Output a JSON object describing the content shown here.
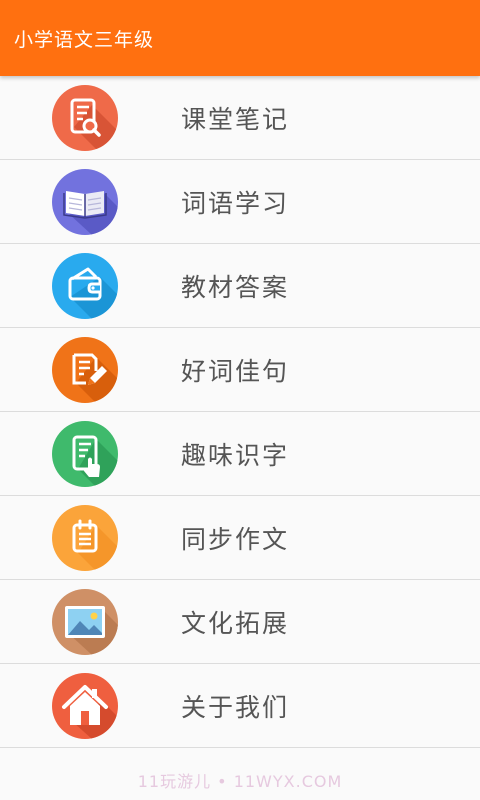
{
  "appbar": {
    "title": "小学语文三年级",
    "color": "#ff7010"
  },
  "menu": [
    {
      "label": "课堂笔记",
      "icon": "notebook-search-icon",
      "color": "#ef6a49"
    },
    {
      "label": "词语学习",
      "icon": "open-book-icon",
      "color": "#7272de"
    },
    {
      "label": "教材答案",
      "icon": "wallet-icon",
      "color": "#29aaee"
    },
    {
      "label": "好词佳句",
      "icon": "document-pencil-icon",
      "color": "#f07318"
    },
    {
      "label": "趣味识字",
      "icon": "tablet-touch-icon",
      "color": "#3fba6c"
    },
    {
      "label": "同步作文",
      "icon": "calendar-note-icon",
      "color": "#fba43a"
    },
    {
      "label": "文化拓展",
      "icon": "landscape-picture-icon",
      "color": "#cf9066"
    },
    {
      "label": "关于我们",
      "icon": "home-icon",
      "color": "#ef5f3f"
    }
  ],
  "watermark": "11玩游儿 • 11WYX.COM"
}
